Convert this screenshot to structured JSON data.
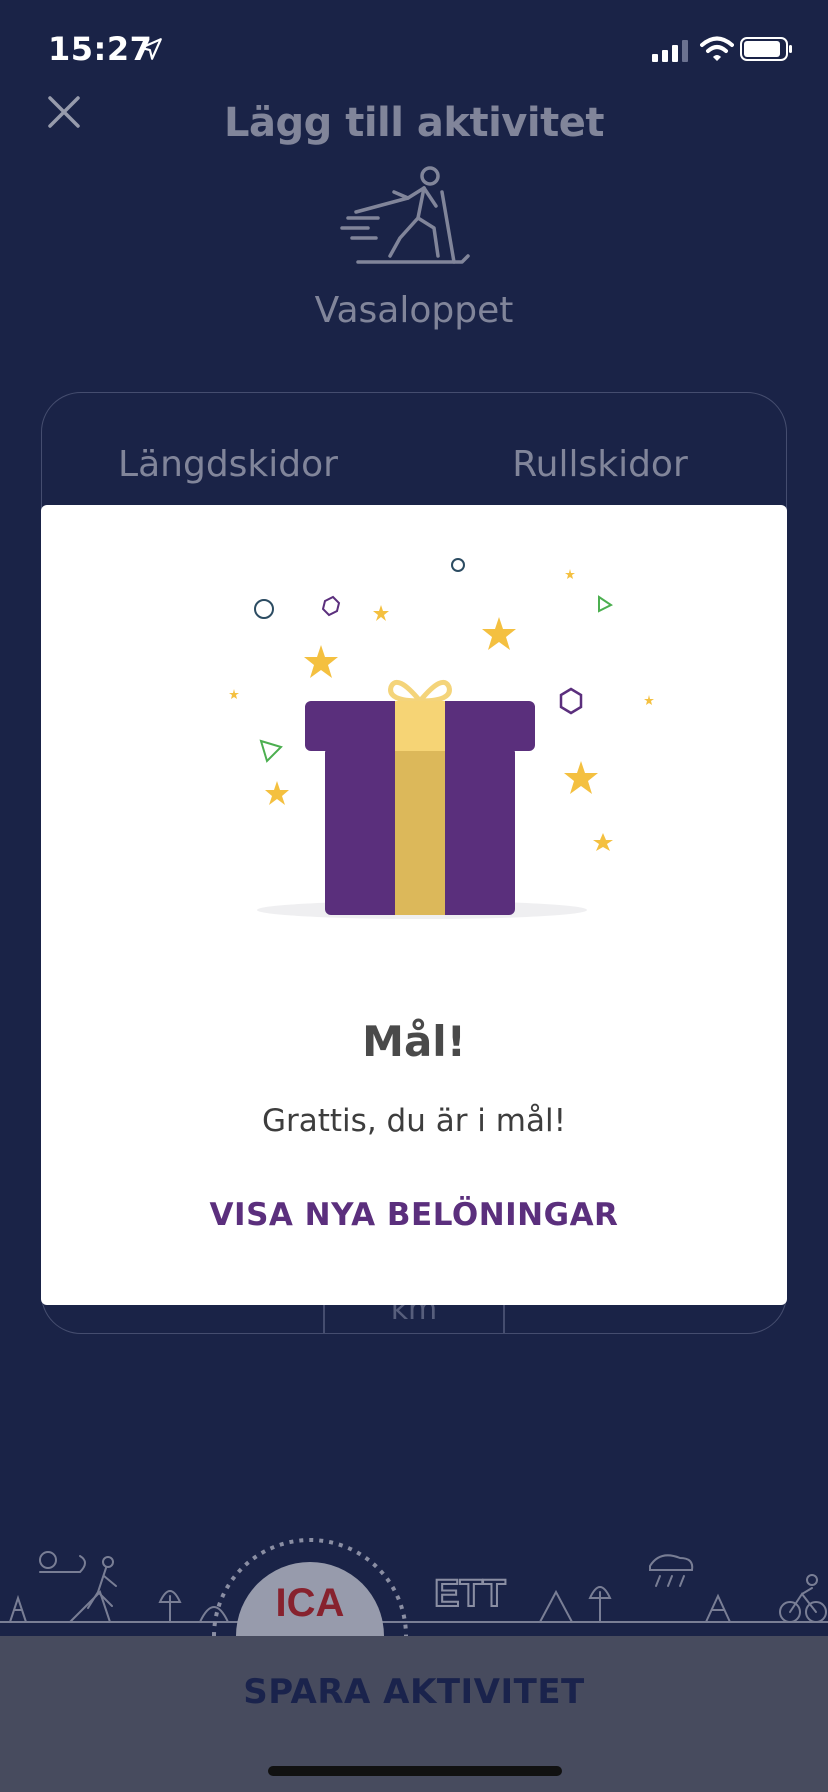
{
  "status_bar": {
    "time": "15:27"
  },
  "header": {
    "title": "Lägg till aktivitet",
    "activity": "Vasaloppet"
  },
  "segmented": {
    "left": "Längdskidor",
    "right": "Rullskidor"
  },
  "inputs": {
    "unit": "km"
  },
  "footer": {
    "save_label": "SPARA AKTIVITET"
  },
  "modal": {
    "title": "Mål!",
    "message": "Grattis, du är i mål!",
    "link": "VISA NYA BELÖNINGAR"
  },
  "colors": {
    "background": "#1a2347",
    "accent_purple": "#5b2f7d",
    "gift_gold": "#dcb85a",
    "star_yellow": "#f4c040"
  }
}
